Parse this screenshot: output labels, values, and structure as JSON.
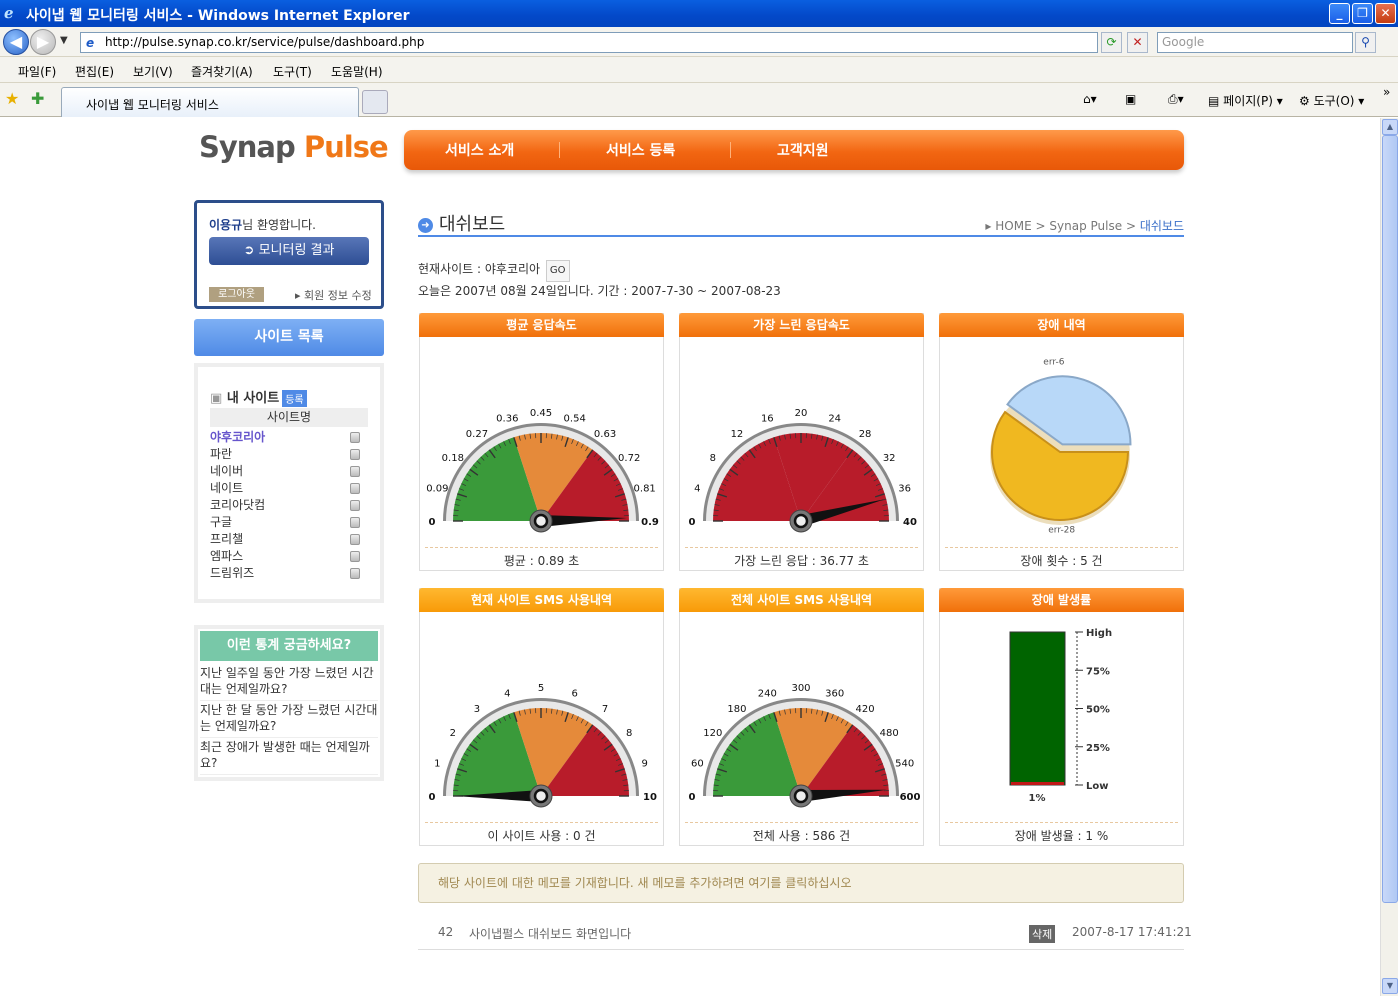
{
  "window": {
    "title": "사이냅 웹 모니터링 서비스 - Windows Internet Explorer"
  },
  "address": {
    "url": "http://pulse.synap.co.kr/service/pulse/dashboard.php",
    "search_placeholder": "Google"
  },
  "menu": [
    "파일(F)",
    "편집(E)",
    "보기(V)",
    "즐겨찾기(A)",
    "도구(T)",
    "도움말(H)"
  ],
  "tab": {
    "title": "사이냅 웹 모니터링 서비스"
  },
  "toolbar": {
    "page_label": "페이지(P)",
    "tools_label": "도구(O)"
  },
  "site": {
    "logo_a": "Synap",
    "logo_b": "Pulse",
    "nav": [
      "서비스 소개",
      "서비스 등록",
      "고객지원"
    ]
  },
  "login": {
    "user": "이용규",
    "welcome_suffix": "님 환영합니다.",
    "monitor_button": "모니터링 결과",
    "logout": "로그아웃",
    "edit_info": "회원 정보 수정"
  },
  "sidebar": {
    "site_list_title": "사이트 목록",
    "my_sites": "내 사이트",
    "register": "등록",
    "col_header": "사이트명",
    "sites": [
      "야후코리아",
      "파란",
      "네이버",
      "네이트",
      "코리아닷컴",
      "구글",
      "프리챌",
      "엠파스",
      "드림위즈"
    ]
  },
  "faq": {
    "title": "이런 통계 궁금하세요?",
    "items": [
      "지난 일주일 동안 가장 느렸던 시간대는 언제일까요?",
      "지난 한 달 동안 가장 느렸던 시간대는 언제일까요?",
      "최근 장애가 발생한 때는 언제일까요?"
    ]
  },
  "dashboard": {
    "title": "대쉬보드",
    "breadcrumb": {
      "home": "HOME",
      "mid": "Synap Pulse",
      "current": "대쉬보드",
      "sep": ">"
    },
    "current_site_label": "현재사이트 : 야후코리아",
    "go": "GO",
    "date_info": "오늘은 2007년 08월 24일입니다. 기간 : 2007-7-30 ~ 2007-08-23"
  },
  "panels": {
    "avg": {
      "title": "평균 응답속도",
      "footer": "평균 : 0.89 초"
    },
    "slow": {
      "title": "가장 느린 응답속도",
      "footer": "가장 느린 응답 : 36.77 초"
    },
    "err": {
      "title": "장애 내역",
      "footer": "장애 횟수 : 5 건"
    },
    "sms_cur": {
      "title": "현재 사이트 SMS 사용내역",
      "footer": "이 사이트 사용 : 0 건"
    },
    "sms_all": {
      "title": "전체 사이트 SMS 사용내역",
      "footer": "전체 사용 : 586 건"
    },
    "rate": {
      "title": "장애 발생률",
      "footer": "장애 발생율 : 1 %"
    }
  },
  "chart_data": [
    {
      "type": "gauge",
      "name": "avg",
      "min": 0,
      "max": 0.9,
      "value": 0.89,
      "ticks": [
        "0",
        "0.09",
        "0.18",
        "0.27",
        "0.36",
        "0.45",
        "0.54",
        "0.63",
        "0.72",
        "0.81",
        "0.9"
      ],
      "colors": [
        "#3a9a3a",
        "#e58a3a",
        "#b81c2a"
      ]
    },
    {
      "type": "gauge",
      "name": "slow",
      "min": 0,
      "max": 40,
      "value": 36.77,
      "ticks": [
        "0",
        "4",
        "8",
        "12",
        "16",
        "20",
        "24",
        "28",
        "32",
        "36",
        "40"
      ],
      "colors": [
        "#b81c2a",
        "#b81c2a",
        "#b81c2a"
      ]
    },
    {
      "type": "pie",
      "name": "err",
      "slices": [
        {
          "label": "err-6",
          "value": 2,
          "color": "#b8d8f8"
        },
        {
          "label": "err-28",
          "value": 3,
          "color": "#f0b820"
        }
      ]
    },
    {
      "type": "gauge",
      "name": "sms_cur",
      "min": 0,
      "max": 10,
      "value": 0,
      "ticks": [
        "0",
        "1",
        "2",
        "3",
        "4",
        "5",
        "6",
        "7",
        "8",
        "9",
        "10"
      ],
      "colors": [
        "#3a9a3a",
        "#e58a3a",
        "#b81c2a"
      ]
    },
    {
      "type": "gauge",
      "name": "sms_all",
      "min": 0,
      "max": 600,
      "value": 586,
      "ticks": [
        "0",
        "60",
        "120",
        "180",
        "240",
        "300",
        "360",
        "420",
        "480",
        "540",
        "600"
      ],
      "colors": [
        "#3a9a3a",
        "#e58a3a",
        "#b81c2a"
      ]
    },
    {
      "type": "bar",
      "name": "rate",
      "value": 1,
      "value_label": "1%",
      "ticks": [
        "High",
        "75%",
        "50%",
        "25%",
        "Low"
      ],
      "colors": [
        "#006400",
        "#c01818"
      ]
    }
  ],
  "memo": {
    "prompt": "해당 사이트에 대한 메모를 기재합니다. 새 메모를 추가하려면 여기를 클릭하십시오",
    "entries": [
      {
        "no": "42",
        "text": "사이냅펄스 대쉬보드 화면입니다",
        "delete": "삭제",
        "date": "2007-8-17 17:41:21"
      }
    ]
  }
}
